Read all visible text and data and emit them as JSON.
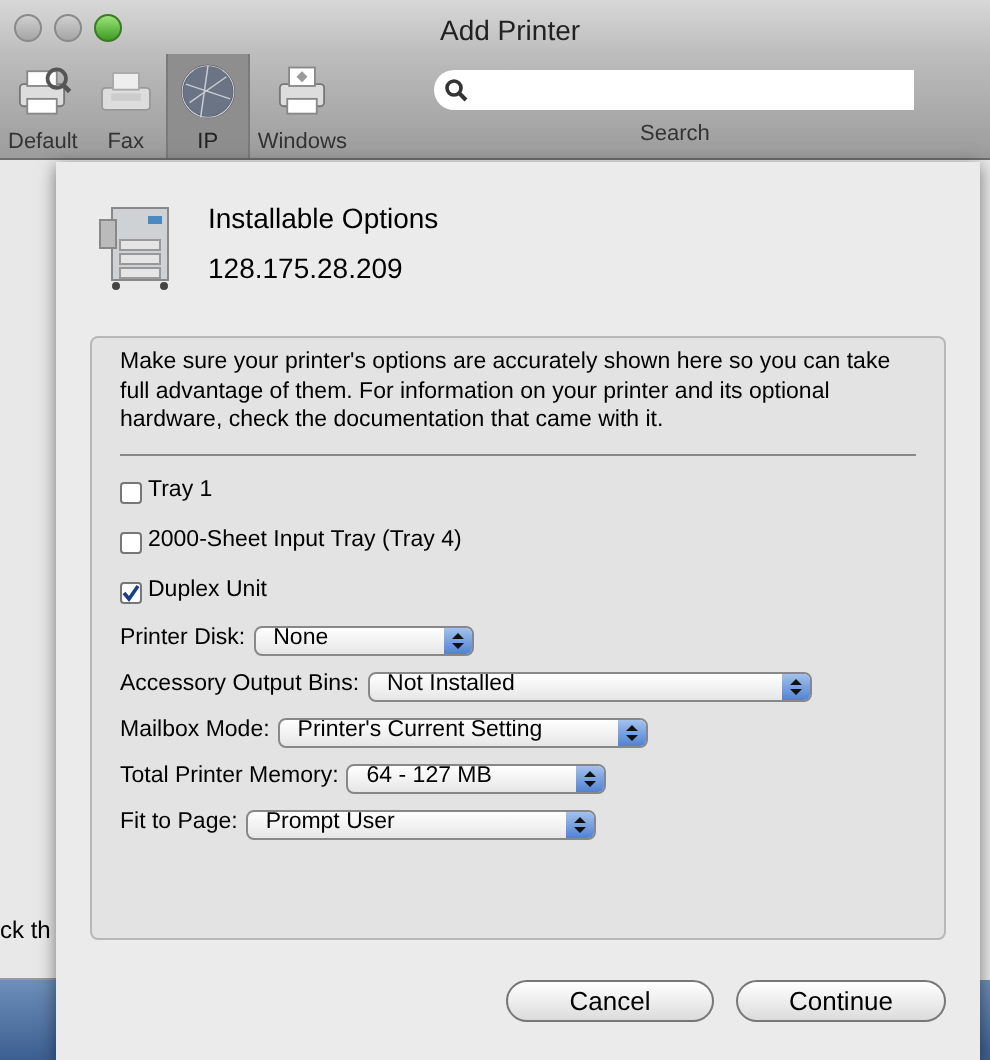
{
  "window": {
    "title": "Add Printer"
  },
  "toolbar": [
    {
      "label": "Default",
      "selected": false
    },
    {
      "label": "Fax",
      "selected": false
    },
    {
      "label": "IP",
      "selected": true
    },
    {
      "label": "Windows",
      "selected": false
    }
  ],
  "search": {
    "label": "Search"
  },
  "background": {
    "lock_hint": "ck th"
  },
  "sheet": {
    "title": "Installable Options",
    "address": "128.175.28.209",
    "description": "Make sure your printer's options are accurately shown here so you can take full advantage of them.  For information on your printer and its optional hardware, check the documentation that came with it.",
    "options": [
      {
        "kind": "checkbox",
        "label": "Tray 1",
        "checked": false
      },
      {
        "kind": "checkbox",
        "label": "2000-Sheet Input Tray (Tray 4)",
        "checked": false
      },
      {
        "kind": "checkbox",
        "label": "Duplex Unit",
        "checked": true
      },
      {
        "kind": "popup",
        "label": "Printer Disk:",
        "value": "None"
      },
      {
        "kind": "popup",
        "label": "Accessory Output Bins:",
        "value": "Not Installed"
      },
      {
        "kind": "popup",
        "label": "Mailbox Mode:",
        "value": "Printer's Current Setting"
      },
      {
        "kind": "popup",
        "label": "Total Printer Memory:",
        "value": "64 - 127 MB"
      },
      {
        "kind": "popup",
        "label": "Fit to Page:",
        "value": "Prompt User"
      }
    ],
    "buttons": [
      "Cancel",
      "Continue"
    ]
  }
}
